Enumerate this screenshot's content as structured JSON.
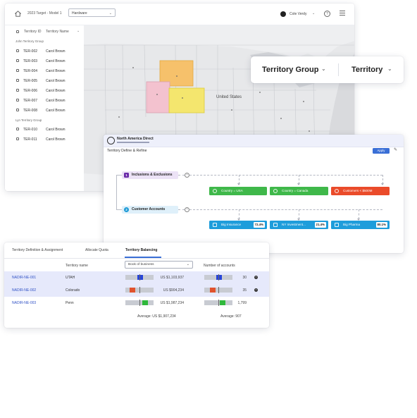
{
  "map_window": {
    "title": "2023 Target - Model 1",
    "dropdown_value": "Hardware",
    "user_name": "Cole Verdy",
    "help_label": "?",
    "list_header": {
      "id": "Territory ID",
      "name": "Territory Name"
    },
    "groups": [
      {
        "label": "John Territory Group",
        "items": [
          {
            "id": "TER-002",
            "name": "Carol Brown"
          },
          {
            "id": "TER-003",
            "name": "Carol Brown"
          },
          {
            "id": "TER-004",
            "name": "Carol Brown"
          },
          {
            "id": "TER-005",
            "name": "Carol Brown"
          },
          {
            "id": "TER-006",
            "name": "Carol Brown"
          },
          {
            "id": "TER-007",
            "name": "Carol Brown"
          },
          {
            "id": "TER-008",
            "name": "Carol Brown"
          }
        ]
      },
      {
        "label": "Lyn Territory Group",
        "items": [
          {
            "id": "TER-010",
            "name": "Carol Brown"
          },
          {
            "id": "TER-011",
            "name": "Carol Brown"
          }
        ]
      }
    ],
    "map_label": "United States",
    "region_colors": {
      "orange": "#f6c16b",
      "yellow": "#f4e66e",
      "pink": "#f3c2cf"
    }
  },
  "group_card": {
    "left_label": "Territory Group",
    "right_label": "Territory"
  },
  "define_window": {
    "brand": "North America Direct",
    "subtitle": "Territory Define & Refine",
    "apply_label": "Apply",
    "step1": {
      "num": "1",
      "label": "Inclusions & Exclusions"
    },
    "step2": {
      "num": "2",
      "label": "Customer Accounts"
    },
    "filters": [
      {
        "label": "Country = USA",
        "color": "#3fb84a"
      },
      {
        "label": "Country = Canada",
        "color": "#3fb84a"
      },
      {
        "label": "Customers < $500M",
        "color": "#ea4b2a"
      }
    ],
    "segments": [
      {
        "label": "Big Insurance",
        "pct": "72.4%"
      },
      {
        "label": "NY Investment...",
        "pct": "21.4%"
      },
      {
        "label": "Big Pharma",
        "pct": "80.1%"
      }
    ]
  },
  "balance_window": {
    "tabs": [
      "Territory Definition & Assignment",
      "Allocate Quota",
      "Territory Balancing"
    ],
    "active_tab": 2,
    "col_name": "Territory name",
    "select_value": "Book of business",
    "col_accounts": "Number of accounts",
    "rows": [
      {
        "id": "NADIR-NE-001",
        "name": "UTAH",
        "bob": "US $1,103,937",
        "accounts": "30",
        "bob_level": 0.62,
        "bob_color": "#2845d8",
        "acc_level": 0.62,
        "acc_color": "#2845d8"
      },
      {
        "id": "NADIR-NE-002",
        "name": "Colorado",
        "bob": "US $904,234",
        "accounts": "35",
        "bob_level": 0.35,
        "bob_color": "#e0522d",
        "acc_level": 0.4,
        "acc_color": "#e0522d"
      },
      {
        "id": "NADIR-NE-003",
        "name": "Penn",
        "bob": "US $1,987,234",
        "accounts": "1,799",
        "bob_level": 0.8,
        "bob_color": "#2fb83b",
        "acc_level": 0.76,
        "acc_color": "#2fb83b"
      }
    ],
    "avg_bob": "Average: US $1,907,234",
    "avg_accounts": "Average: 907"
  }
}
